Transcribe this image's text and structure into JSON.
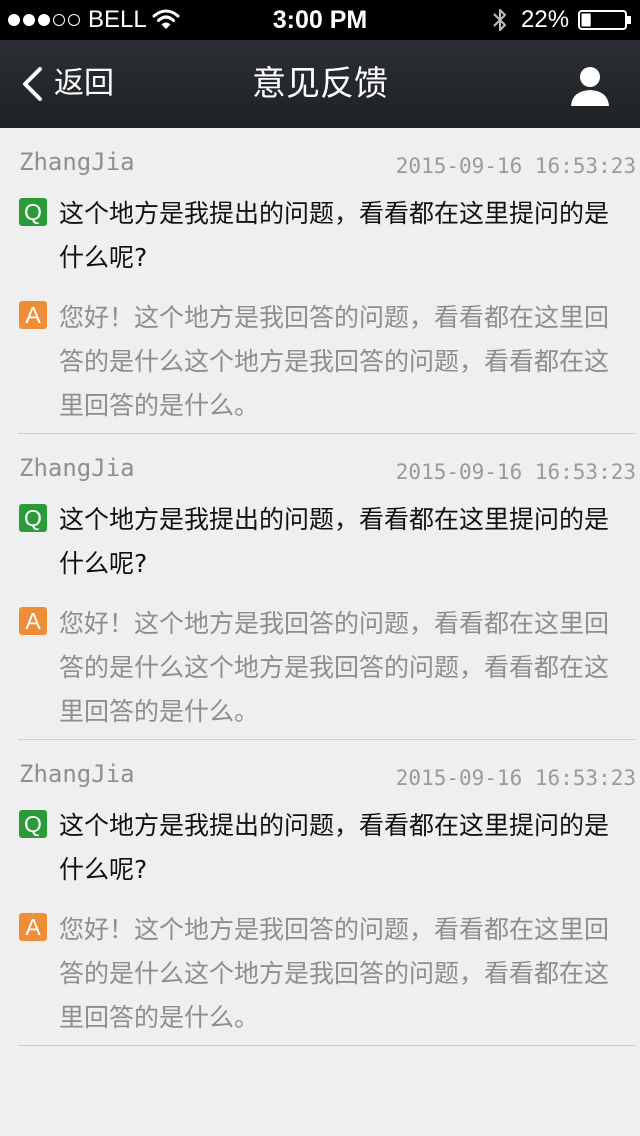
{
  "status_bar": {
    "signal_dots": [
      "full",
      "full",
      "full",
      "empty",
      "empty"
    ],
    "carrier": "BELL",
    "wifi_icon": "wifi-icon",
    "time": "3:00 PM",
    "bluetooth_icon": "bluetooth-icon",
    "battery_percent": "22%",
    "battery_level": 0.22
  },
  "nav": {
    "back_icon": "chevron-left-icon",
    "back_label": "返回",
    "title": "意见反馈",
    "profile_icon": "user-icon"
  },
  "colors": {
    "status_bar_bg": "#000000",
    "nav_bg": "#25282b",
    "page_bg": "#efefef",
    "question_badge": "#2b9b3a",
    "answer_badge": "#ee8e38",
    "author_text": "#8f8f8f",
    "answer_text": "#8e8e8e"
  },
  "feedback": [
    {
      "author": "ZhangJia",
      "time": "2015-09-16 16:53:23",
      "q_badge": "Q",
      "question": "这个地方是我提出的问题，看看都在这里提问的是什么呢?",
      "a_badge": "A",
      "answer": "您好！这个地方是我回答的问题，看看都在这里回答的是什么这个地方是我回答的问题，看看都在这里回答的是什么。"
    },
    {
      "author": "ZhangJia",
      "time": "2015-09-16 16:53:23",
      "q_badge": "Q",
      "question": "这个地方是我提出的问题，看看都在这里提问的是什么呢?",
      "a_badge": "A",
      "answer": "您好！这个地方是我回答的问题，看看都在这里回答的是什么这个地方是我回答的问题，看看都在这里回答的是什么。"
    },
    {
      "author": "ZhangJia",
      "time": "2015-09-16 16:53:23",
      "q_badge": "Q",
      "question": "这个地方是我提出的问题，看看都在这里提问的是什么呢?",
      "a_badge": "A",
      "answer": "您好！这个地方是我回答的问题，看看都在这里回答的是什么这个地方是我回答的问题，看看都在这里回答的是什么。"
    }
  ]
}
